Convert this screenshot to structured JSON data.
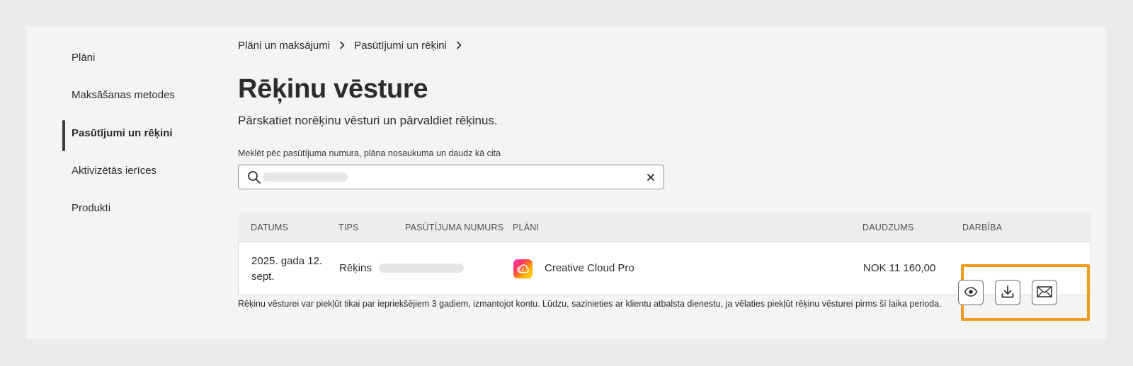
{
  "sidebar": {
    "items": [
      {
        "label": "Plāni"
      },
      {
        "label": "Maksāšanas metodes"
      },
      {
        "label": "Pasūtījumi un rēķini",
        "active": true
      },
      {
        "label": "Aktivizētās ierīces"
      },
      {
        "label": "Produkti"
      }
    ]
  },
  "breadcrumb": {
    "items": [
      "Plāni un maksājumi",
      "Pasūtījumi un rēķini"
    ]
  },
  "page": {
    "title": "Rēķinu vēsture",
    "subtitle": "Pārskatiet norēķinu vēsturi un pārvaldiet rēķinus."
  },
  "search": {
    "label": "Meklēt pēc pasūtījuma numura, plāna nosaukuma un daudz kā cita",
    "clear_icon": "close-icon",
    "value": ""
  },
  "table": {
    "headers": [
      "DATUMS",
      "TIPS",
      "PASŪTĪJUMA NUMURS",
      "PLĀNI",
      "DAUDZUMS",
      "DARBĪBA"
    ],
    "rows": [
      {
        "date": "2025. gada 12. sept.",
        "type": "Rēķins",
        "plan": "Creative Cloud Pro",
        "plan_icon": "creative-cloud-logo-icon",
        "amount": "NOK 11 160,00",
        "actions": [
          "eye-icon",
          "download-icon",
          "mail-icon"
        ]
      }
    ]
  },
  "footnote": "Rēķinu vēsturei var piekļūt tikai par iepriekšējiem 3 gadiem, izmantojot kontu. Lūdzu, sazinieties ar klientu atbalsta dienestu, ja vēlaties piekļūt rēķinu vēsturei pirms šī laika perioda.",
  "colors": {
    "highlight": "#f39a1a",
    "panel": "#f4f4f4",
    "background": "#ebebeb"
  }
}
